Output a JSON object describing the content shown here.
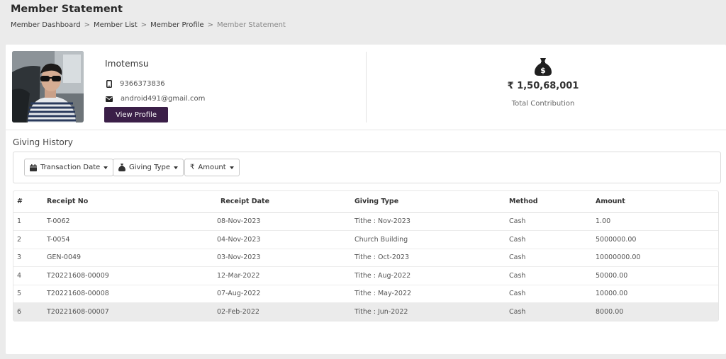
{
  "header": {
    "title": "Member Statement",
    "breadcrumb": [
      "Member Dashboard",
      "Member List",
      "Member Profile",
      "Member Statement"
    ],
    "separator": ">"
  },
  "profile": {
    "name": "Imotemsu",
    "phone": "9366373836",
    "email": "android491@gmail.com",
    "view_profile_label": "View Profile",
    "photo_icon": "profile-photo"
  },
  "summary": {
    "icon": "money-bag-icon",
    "amount": "₹ 1,50,68,001",
    "label": "Total Contribution"
  },
  "giving_history": {
    "title": "Giving History",
    "filters": [
      {
        "icon": "calendar-icon",
        "label": "Transaction Date"
      },
      {
        "icon": "money-bag-icon",
        "label": "Giving Type"
      },
      {
        "icon": "rupee-icon",
        "label": "Amount"
      }
    ],
    "columns": [
      "#",
      "Receipt No",
      "Receipt Date",
      "Giving Type",
      "Method",
      "Amount"
    ],
    "rows": [
      {
        "num": "1",
        "receipt_no": "T-0062",
        "receipt_date": "08-Nov-2023",
        "giving_type": "Tithe : Nov-2023",
        "method": "Cash",
        "amount": "1.00"
      },
      {
        "num": "2",
        "receipt_no": "T-0054",
        "receipt_date": "04-Nov-2023",
        "giving_type": "Church Building",
        "method": "Cash",
        "amount": "5000000.00"
      },
      {
        "num": "3",
        "receipt_no": "GEN-0049",
        "receipt_date": "03-Nov-2023",
        "giving_type": "Tithe : Oct-2023",
        "method": "Cash",
        "amount": "10000000.00"
      },
      {
        "num": "4",
        "receipt_no": "T20221608-00009",
        "receipt_date": "12-Mar-2022",
        "giving_type": "Tithe : Aug-2022",
        "method": "Cash",
        "amount": "50000.00"
      },
      {
        "num": "5",
        "receipt_no": "T20221608-00008",
        "receipt_date": "07-Aug-2022",
        "giving_type": "Tithe : May-2022",
        "method": "Cash",
        "amount": "10000.00"
      },
      {
        "num": "6",
        "receipt_no": "T20221608-00007",
        "receipt_date": "02-Feb-2022",
        "giving_type": "Tithe : Jun-2022",
        "method": "Cash",
        "amount": "8000.00"
      }
    ]
  },
  "colors": {
    "accent": "#3b1f48",
    "page_background": "#ebebeb",
    "card_background": "#ffffff",
    "highlight_row": "#ebebeb"
  }
}
